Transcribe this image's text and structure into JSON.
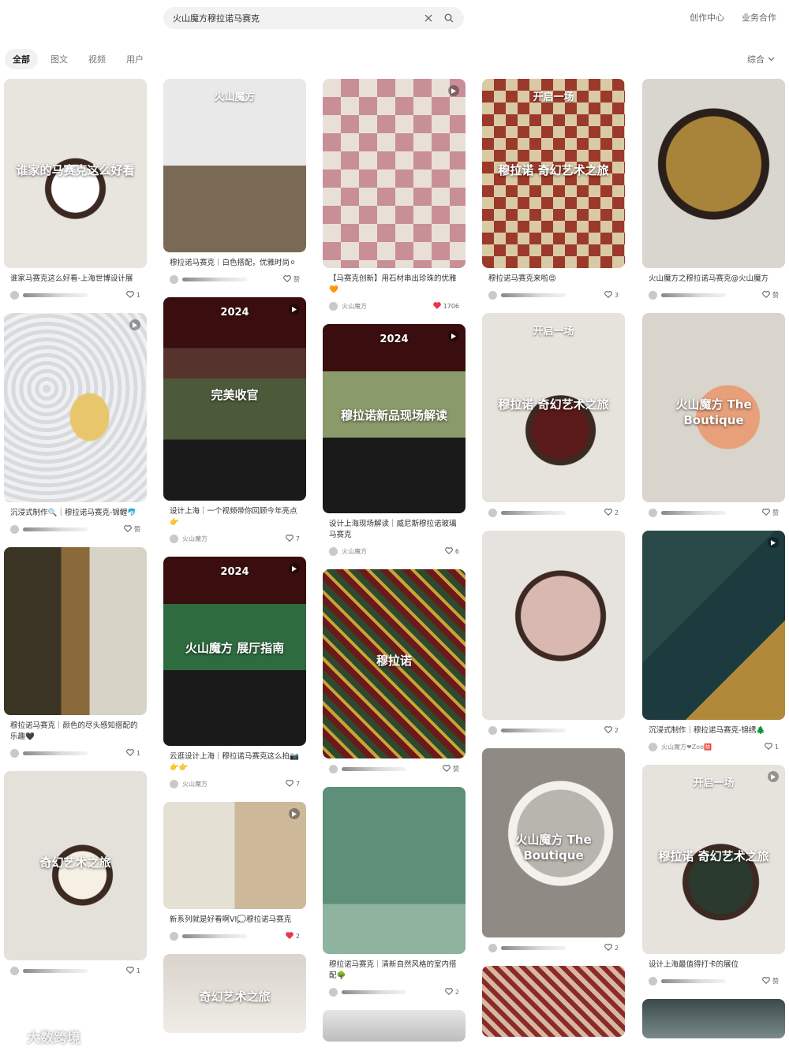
{
  "search": {
    "query": "火山魔方穆拉诺马赛克"
  },
  "top_links": [
    "创作中心",
    "业务合作"
  ],
  "tabs": [
    "全部",
    "图文",
    "视频",
    "用户"
  ],
  "sort": "综合",
  "watermark": "大数跨境",
  "columns": [
    [
      {
        "title": "谁家马赛克这么好看-上海世博设计展",
        "author": "",
        "likes": "1",
        "liked": false,
        "cover_text": "谁家的马赛克这么好看",
        "cover_label": "",
        "video": false
      },
      {
        "title": "沉浸式制作🔍｜穆拉诺马赛克-锦鲤🐬",
        "author": "",
        "likes": "赞",
        "liked": false,
        "cover_text": "",
        "cover_label": "",
        "video": true
      },
      {
        "title": "穆拉诺马赛克｜颜色的尽头感知搭配的乐趣🖤",
        "author": "",
        "likes": "1",
        "liked": false,
        "cover_text": "",
        "cover_label": "",
        "video": false
      },
      {
        "title": "",
        "author": "",
        "likes": "1",
        "liked": false,
        "cover_text": "奇幻艺术之旅",
        "cover_label": "",
        "video": false
      }
    ],
    [
      {
        "title": "穆拉诺马赛克｜白色搭配，优雅时尚⚪",
        "author": "",
        "likes": "赞",
        "liked": false,
        "cover_text": "",
        "cover_label": "火山魔方",
        "video": false
      },
      {
        "title": "设计上海｜一个视频带你回顾今年亮点👉",
        "author": "火山魔方",
        "likes": "7",
        "liked": false,
        "cover_text": "完美收官",
        "cover_label": "2024",
        "video": true
      },
      {
        "title": "云逛设计上海｜穆拉诺马赛克这么拍📷👉👉",
        "author": "火山魔方",
        "likes": "7",
        "liked": false,
        "cover_text": "火山魔方 展厅指南",
        "cover_label": "2024",
        "video": true
      },
      {
        "title": "新系列就是好看啊VI💭穆拉诺马赛克",
        "author": "",
        "likes": "2",
        "liked": true,
        "cover_text": "",
        "cover_label": "",
        "video": true
      },
      {
        "title": "",
        "author": "",
        "likes": "",
        "liked": false,
        "cover_text": "奇幻艺术之旅",
        "cover_label": "",
        "video": false
      }
    ],
    [
      {
        "title": "【马赛克创新】用石材串出珍珠的优雅🧡",
        "author": "火山魔方",
        "likes": "1706",
        "liked": true,
        "cover_text": "",
        "cover_label": "",
        "video": true
      },
      {
        "title": "设计上海现场解读｜威尼斯穆拉诺玻璃马赛克",
        "author": "火山魔方",
        "likes": "6",
        "liked": false,
        "cover_text": "穆拉诺新品现场解读",
        "cover_label": "2024",
        "video": true
      },
      {
        "title": "",
        "author": "",
        "likes": "赞",
        "liked": false,
        "cover_text": "穆拉诺",
        "cover_label": "",
        "video": false
      },
      {
        "title": "穆拉诺马赛克｜清新自然风格的室内搭配🌳",
        "author": "",
        "likes": "2",
        "liked": false,
        "cover_text": "",
        "cover_label": "",
        "video": false
      },
      {
        "title": "",
        "author": "",
        "likes": "",
        "liked": false,
        "cover_text": "",
        "cover_label": "",
        "video": false
      }
    ],
    [
      {
        "title": "穆拉诺马赛克来啦😍",
        "author": "",
        "likes": "3",
        "liked": false,
        "cover_text": "穆拉诺 奇幻艺术之旅",
        "cover_label": "开启一场",
        "video": false
      },
      {
        "title": "",
        "author": "",
        "likes": "2",
        "liked": false,
        "cover_text": "穆拉诺 奇幻艺术之旅",
        "cover_label": "开启一场",
        "video": false
      },
      {
        "title": "",
        "author": "",
        "likes": "2",
        "liked": false,
        "cover_text": "",
        "cover_label": "",
        "video": false
      },
      {
        "title": "",
        "author": "",
        "likes": "2",
        "liked": false,
        "cover_text": "火山魔方 The Boutique",
        "cover_label": "",
        "video": false
      },
      {
        "title": "",
        "author": "",
        "likes": "",
        "liked": false,
        "cover_text": "",
        "cover_label": "",
        "video": false
      }
    ],
    [
      {
        "title": "火山魔方之穆拉诺马赛克@火山魔方",
        "author": "",
        "likes": "赞",
        "liked": false,
        "cover_text": "",
        "cover_label": "",
        "video": false
      },
      {
        "title": "",
        "author": "",
        "likes": "赞",
        "liked": false,
        "cover_text": "火山魔方 The Boutique",
        "cover_label": "",
        "video": false
      },
      {
        "title": "沉浸式制作｜穆拉诺马赛克-锦绣🌲",
        "author": "火山魔方❤Zoe🈲",
        "likes": "1",
        "liked": false,
        "cover_text": "",
        "cover_label": "",
        "video": true
      },
      {
        "title": "设计上海最值得打卡的展位",
        "author": "",
        "likes": "赞",
        "liked": false,
        "cover_text": "穆拉诺 奇幻艺术之旅",
        "cover_label": "开启一场",
        "video": true
      },
      {
        "title": "",
        "author": "",
        "likes": "",
        "liked": false,
        "cover_text": "",
        "cover_label": "",
        "video": false
      }
    ]
  ],
  "colors": {
    "liked": "#e8364a",
    "brand": "#7a2a1f"
  }
}
